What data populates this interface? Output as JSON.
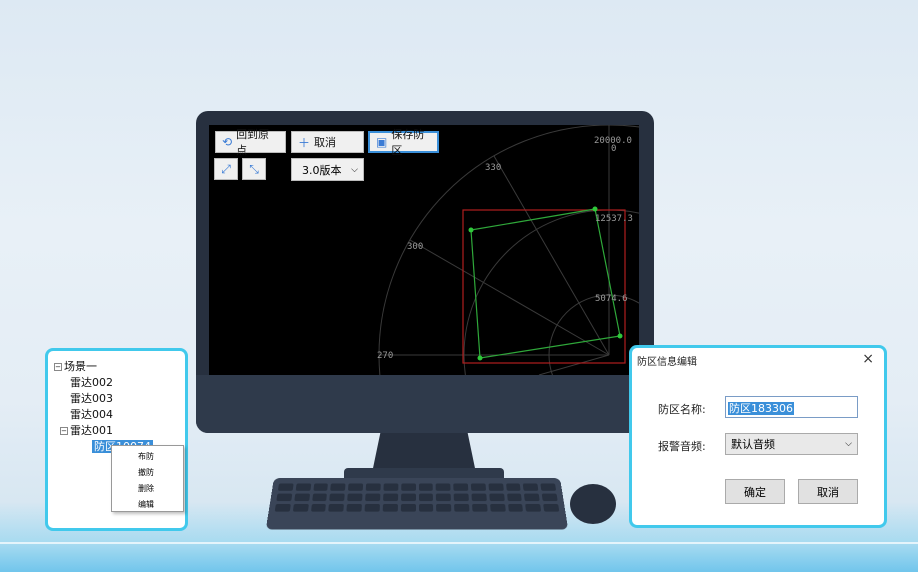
{
  "toolbar": {
    "reset_label": "回到原点",
    "cancel_label": "取消",
    "save_label": "保存防区",
    "version": "3.0版本"
  },
  "radar": {
    "angles": [
      "330",
      "300",
      "270"
    ],
    "ranges": [
      "20000.0",
      "0",
      "12537.3",
      "5074.6"
    ]
  },
  "tree": {
    "root": "场景一",
    "items": [
      "雷达002",
      "雷达003",
      "雷达004",
      "雷达001"
    ],
    "zone": "防区10074"
  },
  "context_menu": [
    "布防",
    "撤防",
    "删除",
    "编辑"
  ],
  "dialog": {
    "title": "防区信息编辑",
    "name_label": "防区名称:",
    "name_value": "防区183306",
    "sound_label": "报警音频:",
    "sound_value": "默认音频",
    "ok": "确定",
    "cancel": "取消"
  }
}
